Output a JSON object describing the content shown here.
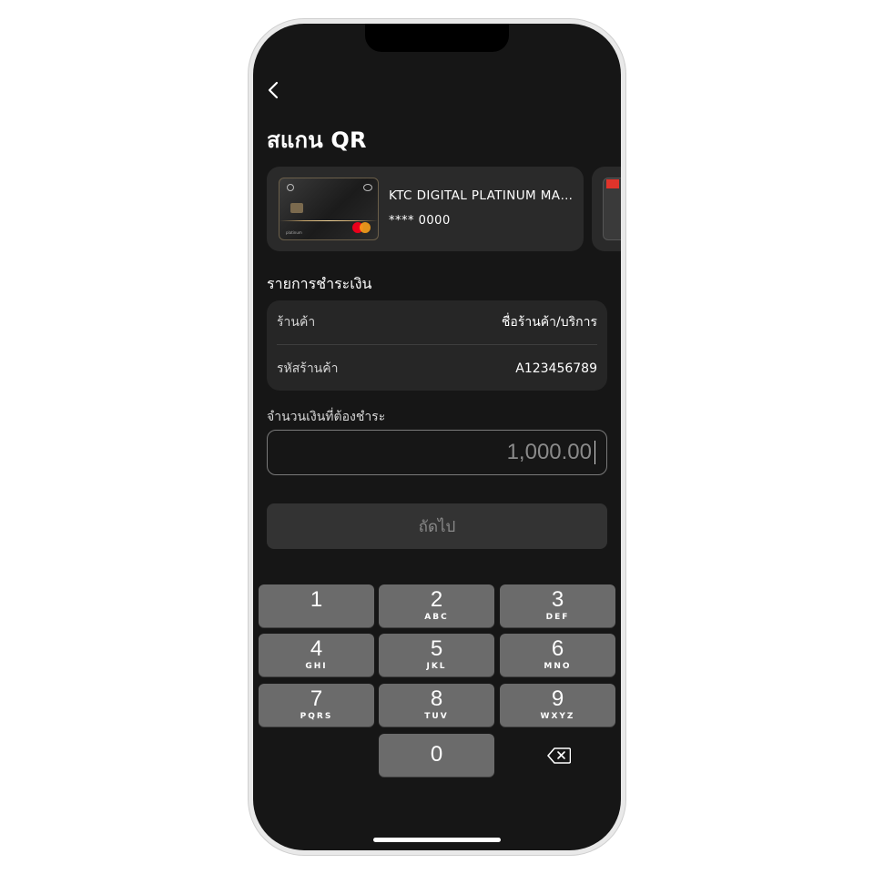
{
  "header": {
    "title": "สแกน QR"
  },
  "card": {
    "name": "KTC DIGITAL PLATINUM MASTERCARD",
    "number": "**** 0000",
    "thumb_tier": "platinum"
  },
  "payment": {
    "section_title": "รายการชำระเงิน",
    "rows": [
      {
        "label": "ร้านค้า",
        "value": "ชื่อร้านค้า/บริการ"
      },
      {
        "label": "รหัสร้านค้า",
        "value": "A123456789"
      }
    ]
  },
  "amount": {
    "label": "จำนวนเงินที่ต้องชำระ",
    "value": "1,000.00"
  },
  "next_button": {
    "label": "ถัดไป"
  },
  "keypad": {
    "keys": [
      {
        "digit": "1",
        "letters": ""
      },
      {
        "digit": "2",
        "letters": "ABC"
      },
      {
        "digit": "3",
        "letters": "DEF"
      },
      {
        "digit": "4",
        "letters": "GHI"
      },
      {
        "digit": "5",
        "letters": "JKL"
      },
      {
        "digit": "6",
        "letters": "MNO"
      },
      {
        "digit": "7",
        "letters": "PQRS"
      },
      {
        "digit": "8",
        "letters": "TUV"
      },
      {
        "digit": "9",
        "letters": "WXYZ"
      },
      {
        "digit": "0",
        "letters": ""
      }
    ]
  },
  "icons": {
    "back": "chevron-left-icon",
    "delete": "backspace-icon"
  },
  "colors": {
    "background": "#161616",
    "panel": "#262626",
    "key": "#6b6b6b",
    "button_disabled": "#333333",
    "mastercard_red": "#eb001b",
    "mastercard_orange": "#f79e1b",
    "brand_red": "#e0342b"
  }
}
